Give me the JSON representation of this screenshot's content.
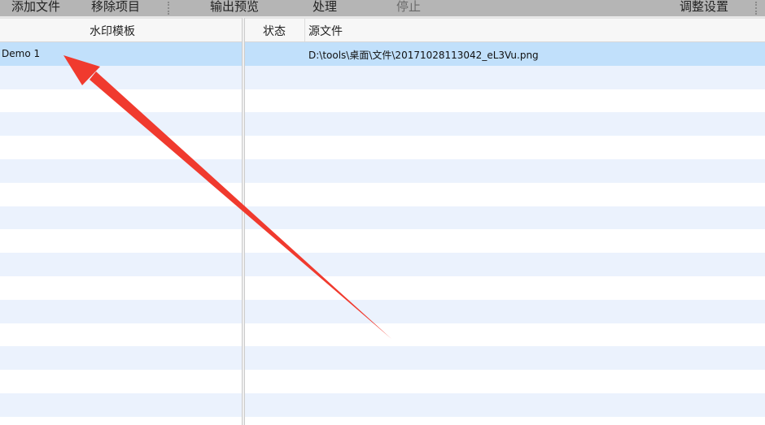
{
  "toolbar": {
    "add_file": "添加文件",
    "remove_item": "移除项目",
    "preview_output": "输出预览",
    "process": "处理",
    "stop": "停止",
    "settings": "调整设置"
  },
  "left_table": {
    "header": "水印模板",
    "rows": [
      "Demo 1"
    ]
  },
  "right_table": {
    "headers": {
      "status": "状态",
      "source": "源文件"
    },
    "rows": [
      {
        "status": "",
        "source": "D:\\tools\\桌面\\文件\\20171028113042_eL3Vu.png"
      }
    ]
  },
  "colors": {
    "toolbar": "#b5b5b5",
    "selected": "#c1e0fb",
    "stripe": "#ebf2fd",
    "arrow": "#f03a2e"
  }
}
